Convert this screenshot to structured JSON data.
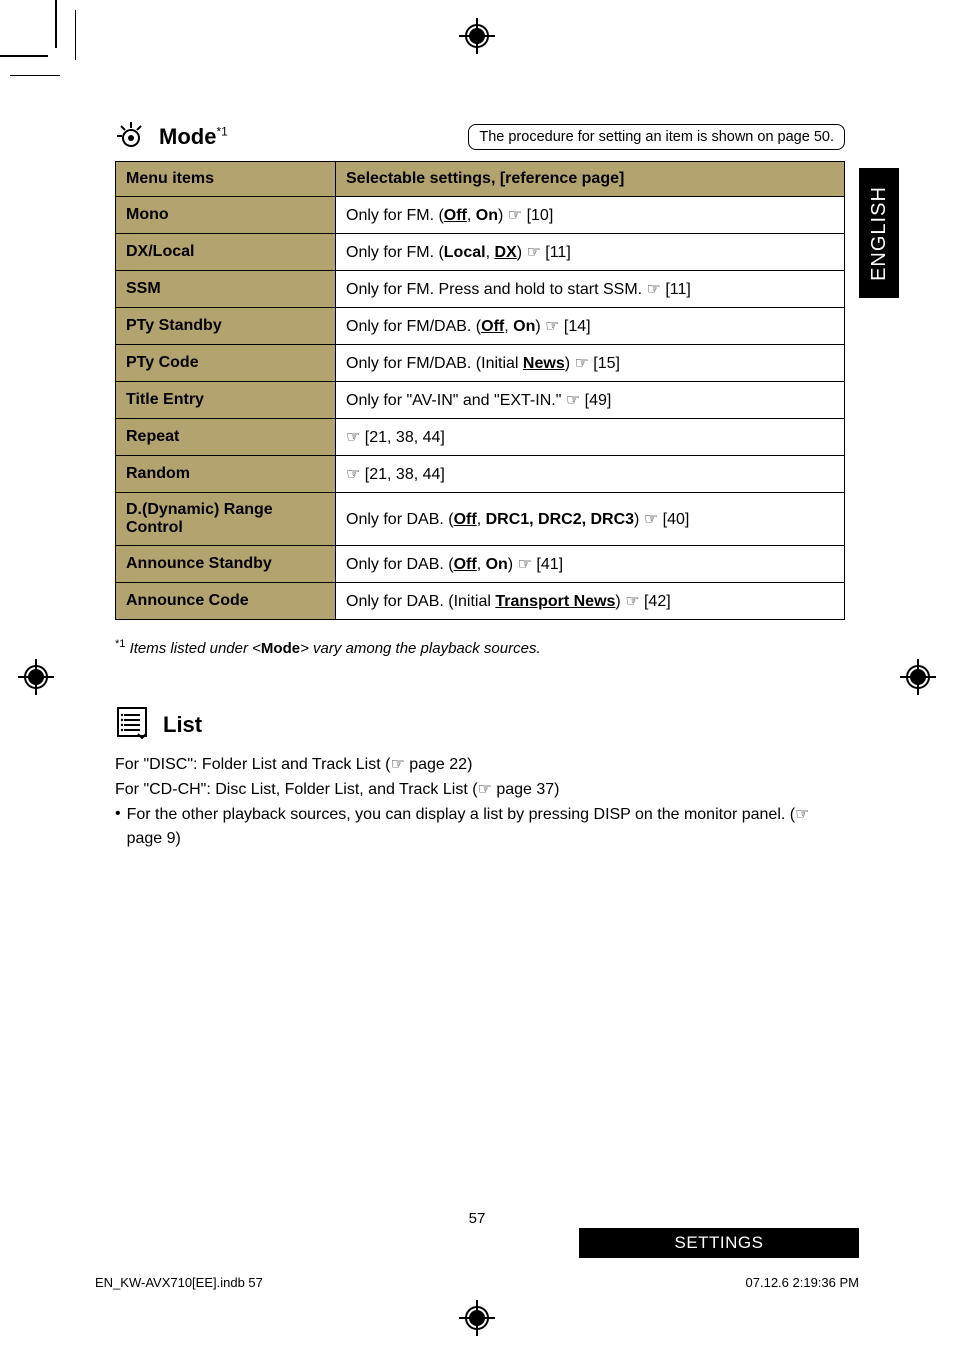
{
  "side_tab": "ENGLISH",
  "mode": {
    "title": "Mode",
    "sup": "*1",
    "proc_note": "The procedure for setting an item is shown on page 50."
  },
  "table": {
    "head_left": "Menu items",
    "head_right": "Selectable settings, [reference page]",
    "rows": [
      {
        "label": "Mono",
        "val_html": "Only for FM. (<span class='b u'>Off</span>, <span class='b'>On</span>) <span class='ptr'>☞</span> [10]"
      },
      {
        "label": "DX/Local",
        "val_html": "Only for FM. (<span class='b'>Local</span>, <span class='b u'>DX</span>) <span class='ptr'>☞</span> [11]"
      },
      {
        "label": "SSM",
        "val_html": "Only for FM. Press and hold to start SSM. <span class='ptr'>☞</span> [11]"
      },
      {
        "label": "PTy Standby",
        "val_html": "Only for FM/DAB. (<span class='b u'>Off</span>, <span class='b'>On</span>) <span class='ptr'>☞</span> [14]"
      },
      {
        "label": "PTy Code",
        "val_html": "Only for FM/DAB. (Initial <span class='b u'>News</span>) <span class='ptr'>☞</span> [15]"
      },
      {
        "label": "Title Entry",
        "val_html": "Only for \"AV-IN\" and \"EXT-IN.\" <span class='ptr'>☞</span> [49]"
      },
      {
        "label": "Repeat",
        "val_html": "<span class='ptr'>☞</span> [21, 38, 44]"
      },
      {
        "label": "Random",
        "val_html": "<span class='ptr'>☞</span> [21, 38, 44]"
      },
      {
        "label": "D.(Dynamic) Range Control",
        "val_html": "Only for DAB. (<span class='b u'>Off</span>, <span class='b'>DRC1, DRC2, DRC3</span>) <span class='ptr'>☞</span> [40]"
      },
      {
        "label": "Announce Standby",
        "val_html": "Only for DAB. (<span class='b u'>Off</span>, <span class='b'>On</span>) <span class='ptr'>☞</span> [41]"
      },
      {
        "label": "Announce Code",
        "val_html": "Only for DAB. (Initial <span class='b u'>Transport News</span>) <span class='ptr'>☞</span> [42]"
      }
    ]
  },
  "footnote": {
    "sup": "*1",
    "text_html": "Items listed under &lt;<span class='b' style='font-style:normal'>Mode</span>&gt; vary among the playback sources."
  },
  "list": {
    "title": "List",
    "line1_html": "For \"DISC\": Folder List and Track List (<span class='ptr'>☞</span> page 22)",
    "line2_html": "For \"CD-CH\": Disc List, Folder List, and Track List (<span class='ptr'>☞</span> page 37)",
    "bullet_html": "For the other playback sources, you can display a list by pressing DISP on the monitor panel. (<span class='ptr'>☞</span> page 9)"
  },
  "footer": {
    "page_num": "57",
    "settings": "SETTINGS",
    "left": "EN_KW-AVX710[EE].indb   57",
    "right": "07.12.6   2:19:36 PM"
  }
}
